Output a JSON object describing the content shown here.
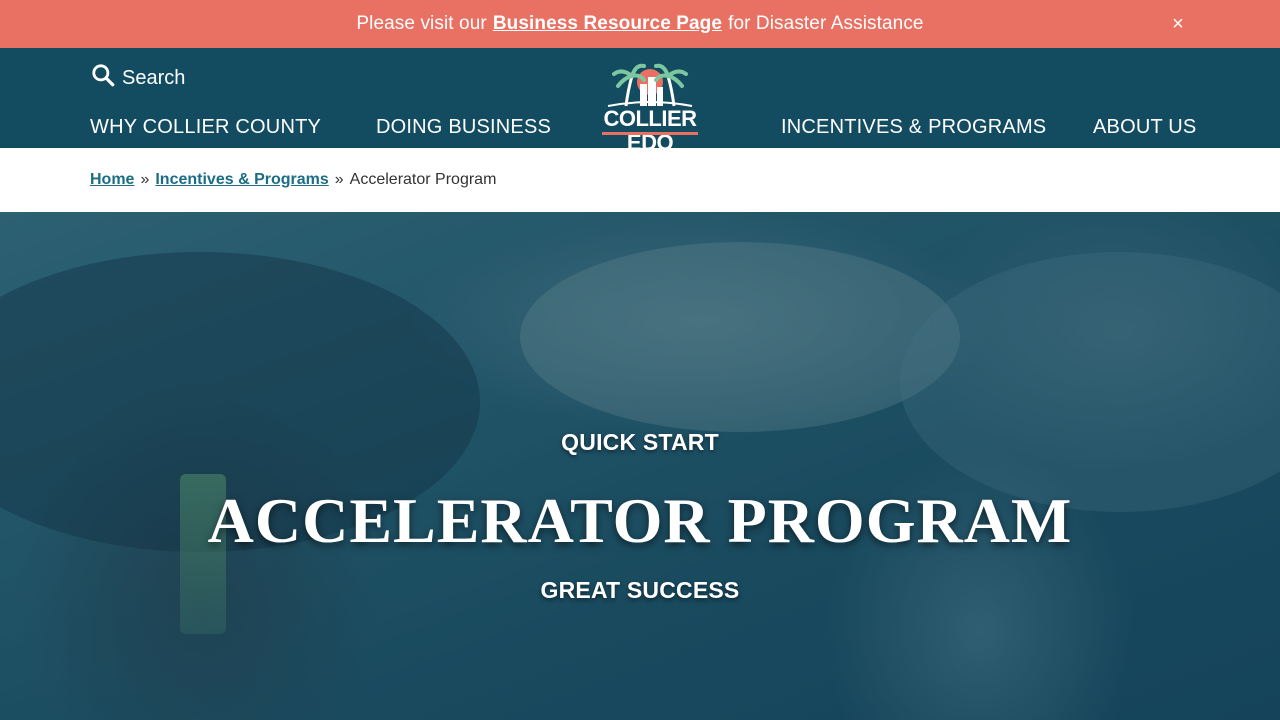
{
  "alert": {
    "prefix": "Please visit our",
    "link_label": "Business Resource Page",
    "suffix": "for Disaster Assistance",
    "close_label": "×"
  },
  "header": {
    "search_label": "Search",
    "logo_text": "COLLIER EDO",
    "nav": {
      "why": "WHY COLLIER COUNTY",
      "doing": "DOING BUSINESS",
      "incentives": "INCENTIVES & PROGRAMS",
      "about": "ABOUT US"
    }
  },
  "breadcrumb": {
    "home": "Home",
    "separator": "»",
    "parent": "Incentives & Programs",
    "current": "Accelerator Program"
  },
  "hero": {
    "kicker": "QUICK START",
    "title": "ACCELERATOR PROGRAM",
    "subtitle": "GREAT SUCCESS"
  },
  "colors": {
    "alert_bg": "#e87163",
    "header_bg": "#134c61",
    "link": "#1b6d85",
    "hero_tint": "#1e4d60"
  },
  "icons": {
    "search": "search-icon",
    "close": "close-icon",
    "logo": "palm-tree-logo-icon"
  }
}
